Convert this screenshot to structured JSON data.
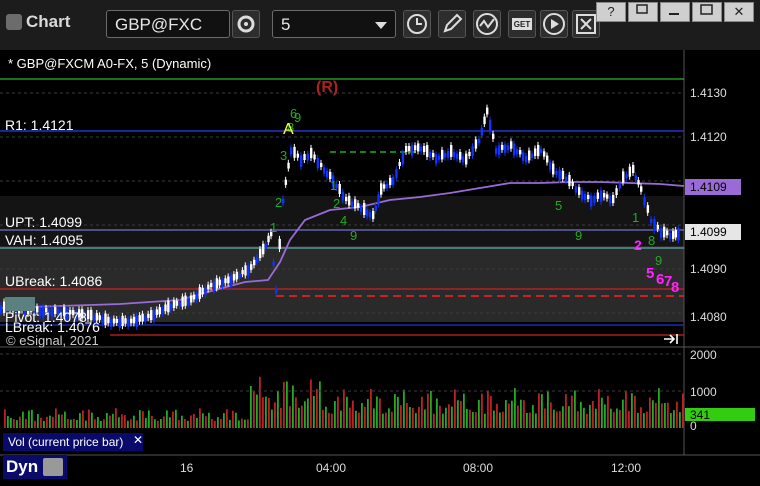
{
  "app": {
    "title": "Chart"
  },
  "toolbar": {
    "symbol": "GBP@FXC",
    "interval": "5",
    "window_buttons": [
      "?",
      "",
      "",
      "✕"
    ]
  },
  "chart": {
    "symbol_line": "* GBP@FXCM A0-FX, 5 (Dynamic)",
    "copyright": "© eSignal, 2021",
    "levels": {
      "r1": "R1: 1.4121",
      "upt": "UPT: 1.4099",
      "vah": "VAH: 1.4095",
      "ubreak": "UBreak: 1.4086",
      "pivot": "Pivot: 1.4078",
      "lbreak": "LBreak: 1.4076",
      "r_marker": "(R)",
      "a_marker": "A"
    },
    "price_axis": [
      "1.4130",
      "1.4120",
      "1.4110",
      "1.4100",
      "1.4090",
      "1.4080"
    ],
    "price_tags": {
      "ma": "1.4109",
      "last": "1.4099"
    },
    "colors": {
      "up_candle": "#ffffff",
      "down_candle": "#1133ff",
      "ma_line": "#9a6bd6",
      "r1_line": "#2233cc",
      "break_line": "#cc2222",
      "green_line": "#22bb22",
      "magenta": "#ff22ff"
    }
  },
  "volume": {
    "label": "Vol (current price bar)",
    "axis": [
      "2000",
      "1000",
      "0"
    ],
    "current": "341",
    "colors": {
      "up": "#22aa22",
      "down": "#bb2222"
    }
  },
  "time_axis": [
    "16",
    "04:00",
    "08:00",
    "12:00"
  ],
  "status": {
    "mode": "Dyn"
  }
}
